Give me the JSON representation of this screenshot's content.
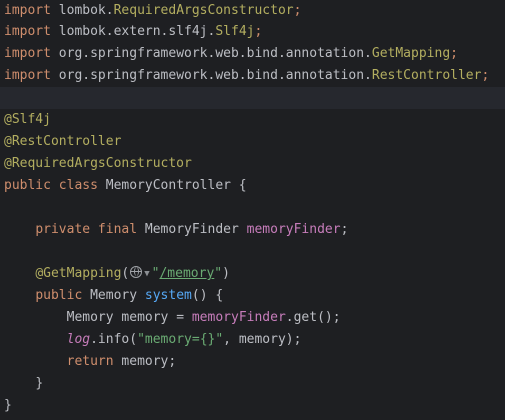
{
  "editor": {
    "lines": [
      {
        "prefix": "import ",
        "pkg": "lombok.",
        "cls": "RequiredArgsConstructor",
        "end": ";"
      },
      {
        "prefix": "import ",
        "pkg": "lombok.extern.slf4j.",
        "cls": "Slf4j",
        "end": ";"
      },
      {
        "prefix": "import ",
        "pkg": "org.springframework.web.bind.annotation.",
        "cls": "GetMapping",
        "end": ";"
      },
      {
        "prefix": "import ",
        "pkg": "org.springframework.web.bind.annotation.",
        "cls": "RestController",
        "end": ";"
      }
    ],
    "annotations": {
      "slf4j": "@Slf4j",
      "rest_controller": "@RestController",
      "required_args": "@RequiredArgsConstructor"
    },
    "class_decl": {
      "kw": "public class ",
      "name": "MemoryController",
      "open": " {"
    },
    "field_decl": {
      "kw": "private final ",
      "type": "MemoryFinder ",
      "name": "memoryFinder",
      "end": ";"
    },
    "get_mapping": {
      "annot": "@GetMapping",
      "open": "(",
      "quote_open": "\"",
      "path": "/memory",
      "quote_close": "\"",
      "close": ")"
    },
    "method_decl": {
      "kw": "public ",
      "type": "Memory ",
      "name": "system",
      "rest": "() {"
    },
    "stmt1": {
      "lhs": "Memory memory = ",
      "field": "memoryFinder",
      "rest": ".get();"
    },
    "stmt2": {
      "log": "log",
      "dot": ".info(",
      "str": "\"memory={}\"",
      "rest": ", memory);"
    },
    "stmt3": {
      "kw": "return ",
      "rest": "memory;"
    },
    "close_method": "}",
    "close_class": "}"
  },
  "icons": {
    "inlay_globe": "globe-icon",
    "inlay_chevron": "chevron-down-icon"
  },
  "colors": {
    "background": "#1e1f22",
    "keyword": "#cf8e6d",
    "annotation": "#b3ae60",
    "field": "#c77dbb",
    "method": "#56a8f5",
    "string": "#6aab73",
    "text": "#bcbec4"
  }
}
